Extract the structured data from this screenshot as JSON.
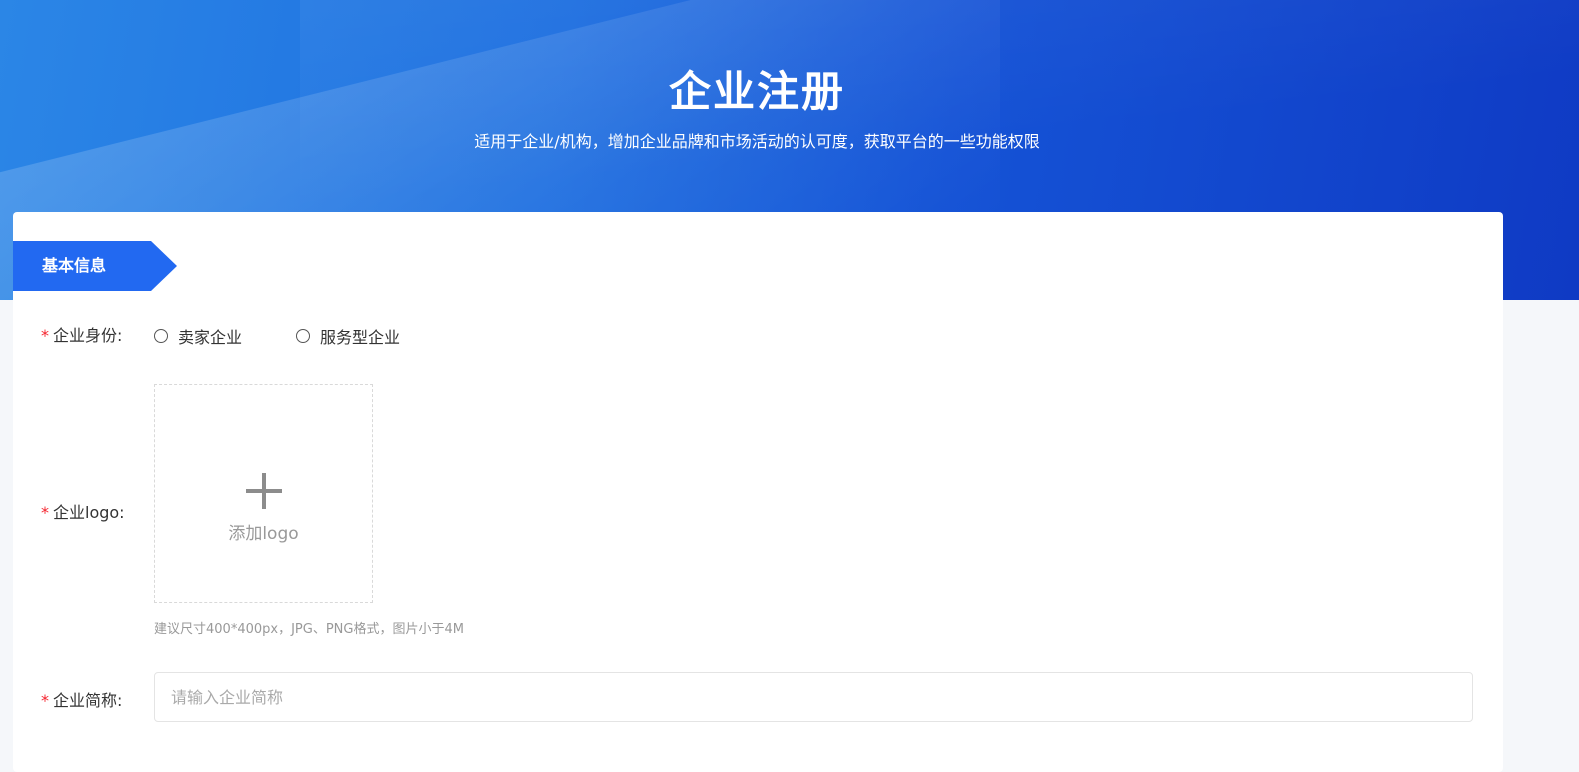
{
  "hero": {
    "title": "企业注册",
    "subtitle": "适用于企业/机构，增加企业品牌和市场活动的认可度，获取平台的一些功能权限"
  },
  "section": {
    "tag": "基本信息"
  },
  "form": {
    "required_mark": "*",
    "identity": {
      "label": "企业身份:",
      "options": [
        "卖家企业",
        "服务型企业"
      ]
    },
    "logo": {
      "label": "企业logo:",
      "upload_text": "添加logo",
      "hint": "建议尺寸400*400px，JPG、PNG格式，图片小于4M",
      "icon": "plus-icon"
    },
    "short_name": {
      "label": "企业简称:",
      "placeholder": "请输入企业简称",
      "value": ""
    }
  },
  "colors": {
    "accent": "#2269f1",
    "required": "#f5222d"
  }
}
